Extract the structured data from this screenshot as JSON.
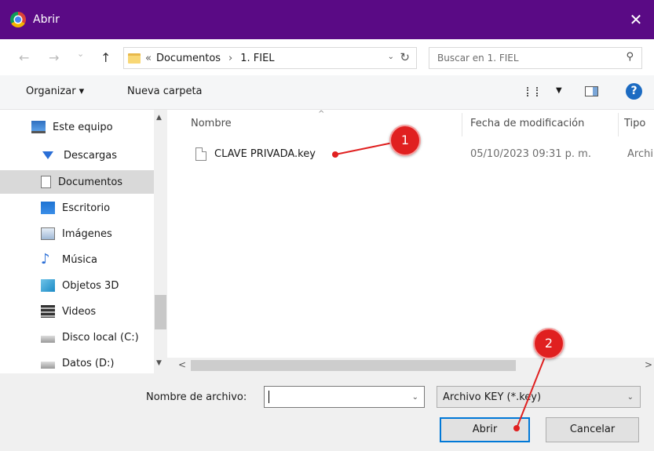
{
  "window": {
    "title": "Abrir",
    "close_glyph": "✕"
  },
  "address": {
    "back_glyph": "←",
    "forward_glyph": "→",
    "history_glyph": "⌄",
    "up_glyph": "↑",
    "overflow": "«",
    "crumb1": "Documentos",
    "sep": "›",
    "crumb2": "1. FIEL",
    "dropdown_glyph": "⌄",
    "refresh_glyph": "↻",
    "search_placeholder": "Buscar en 1. FIEL",
    "search_glyph": "⚲"
  },
  "toolbar": {
    "organize": "Organizar ▾",
    "new_folder": "Nueva carpeta",
    "view_caret": "▼",
    "help": "?"
  },
  "sidebar": {
    "items": [
      {
        "label": "Este equipo",
        "icon": "pc-icon"
      },
      {
        "label": "Descargas",
        "icon": "download-icon"
      },
      {
        "label": "Documentos",
        "icon": "documents-icon",
        "selected": true
      },
      {
        "label": "Escritorio",
        "icon": "desktop-icon"
      },
      {
        "label": "Imágenes",
        "icon": "pictures-icon"
      },
      {
        "label": "Música",
        "icon": "music-icon"
      },
      {
        "label": "Objetos 3D",
        "icon": "3d-objects-icon"
      },
      {
        "label": "Videos",
        "icon": "videos-icon"
      },
      {
        "label": "Disco local (C:)",
        "icon": "drive-icon"
      },
      {
        "label": "Datos (D:)",
        "icon": "drive-icon"
      }
    ],
    "scroll_up": "▲",
    "scroll_down": "▼"
  },
  "files": {
    "columns": {
      "name": "Nombre",
      "modified": "Fecha de modificación",
      "type": "Tipo"
    },
    "sort_glyph": "^",
    "rows": [
      {
        "name": "CLAVE PRIVADA.key",
        "modified": "05/10/2023 09:31 p. m.",
        "type": "Archi"
      }
    ],
    "scroll_left": "<",
    "scroll_right": ">"
  },
  "bottom": {
    "filename_label": "Nombre de archivo:",
    "filename_value": "",
    "filename_dropdown": "⌄",
    "filter_value": "Archivo KEY (*.key)",
    "filter_dropdown": "⌄",
    "open_button": "Abrir",
    "cancel_button": "Cancelar"
  },
  "annotations": {
    "callout1": "1",
    "callout2": "2",
    "color": "#e02020"
  }
}
